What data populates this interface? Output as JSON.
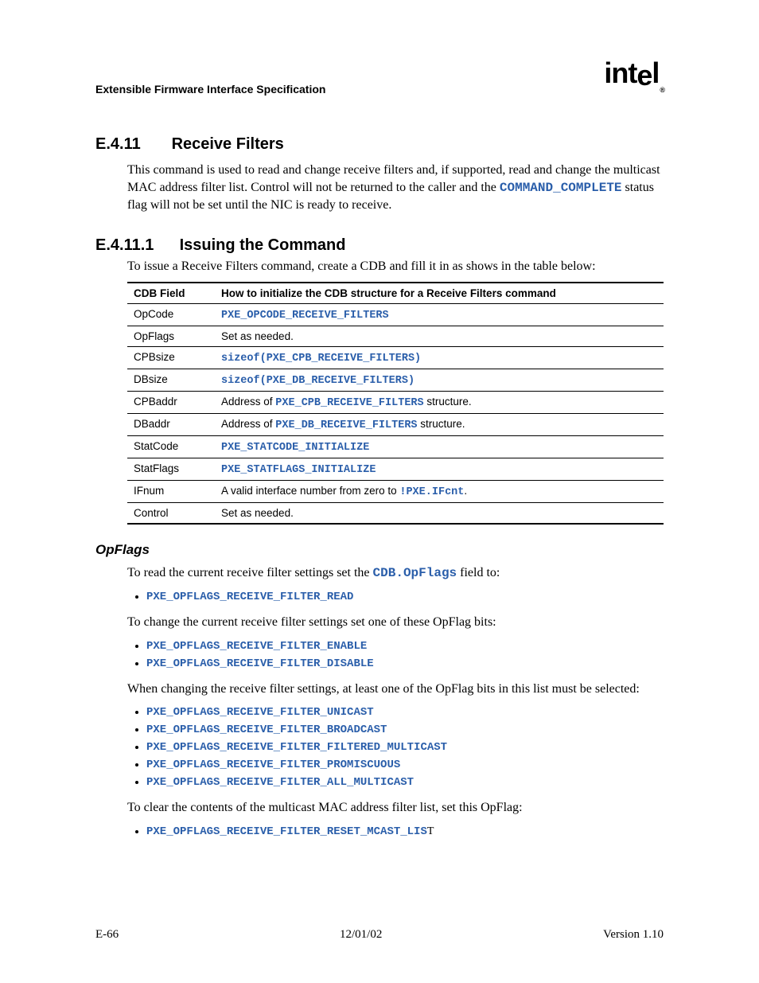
{
  "header": {
    "doc_title": "Extensible Firmware Interface Specification",
    "logo_text": "intel"
  },
  "section": {
    "num": "E.4.11",
    "title": "Receive Filters",
    "body_prefix": "This command is used to read and change receive filters and, if supported, read and change the multicast MAC address filter list.  Control will not be returned to the caller and the ",
    "body_code": "COMMAND_COMPLETE",
    "body_suffix": " status flag will not be set until the NIC is ready to receive."
  },
  "subsection": {
    "num": "E.4.11.1",
    "title": "Issuing the Command",
    "intro": "To issue a Receive Filters command, create a CDB and fill it in as shows in the table below:"
  },
  "table": {
    "head_field": "CDB Field",
    "head_desc": "How to initialize the CDB structure for a Receive Filters command",
    "rows": [
      {
        "field": "OpCode",
        "type": "code",
        "text": "PXE_OPCODE_RECEIVE_FILTERS"
      },
      {
        "field": "OpFlags",
        "type": "plain",
        "text": "Set as needed."
      },
      {
        "field": "CPBsize",
        "type": "code",
        "text": "sizeof(PXE_CPB_RECEIVE_FILTERS)"
      },
      {
        "field": "DBsize",
        "type": "code",
        "text": "sizeof(PXE_DB_RECEIVE_FILTERS)"
      },
      {
        "field": "CPBaddr",
        "type": "mix",
        "pre": "Address of ",
        "code": "PXE_CPB_RECEIVE_FILTERS",
        "post": " structure."
      },
      {
        "field": "DBaddr",
        "type": "mix",
        "pre": "Address of ",
        "code": "PXE_DB_RECEIVE_FILTERS",
        "post": " structure."
      },
      {
        "field": "StatCode",
        "type": "code",
        "text": "PXE_STATCODE_INITIALIZE"
      },
      {
        "field": "StatFlags",
        "type": "code",
        "text": "PXE_STATFLAGS_INITIALIZE"
      },
      {
        "field": "IFnum",
        "type": "mix",
        "pre": "A valid interface number from zero to ",
        "code": "!PXE.IFcnt",
        "post": "."
      },
      {
        "field": "Control",
        "type": "plain",
        "text": "Set as needed."
      }
    ]
  },
  "opflags": {
    "heading": "OpFlags",
    "p1_pre": "To read the current receive filter settings set the ",
    "p1_code": "CDB.OpFlags",
    "p1_post": " field to:",
    "list1": [
      "PXE_OPFLAGS_RECEIVE_FILTER_READ"
    ],
    "p2": "To change the current receive filter settings set one of these OpFlag bits:",
    "list2": [
      "PXE_OPFLAGS_RECEIVE_FILTER_ENABLE",
      "PXE_OPFLAGS_RECEIVE_FILTER_DISABLE"
    ],
    "p3": "When changing the receive filter settings, at least one of the OpFlag bits in this list must be selected:",
    "list3": [
      "PXE_OPFLAGS_RECEIVE_FILTER_UNICAST",
      "PXE_OPFLAGS_RECEIVE_FILTER_BROADCAST",
      "PXE_OPFLAGS_RECEIVE_FILTER_FILTERED_MULTICAST",
      "PXE_OPFLAGS_RECEIVE_FILTER_PROMISCUOUS",
      "PXE_OPFLAGS_RECEIVE_FILTER_ALL_MULTICAST"
    ],
    "p4": "To clear the contents of the multicast MAC address filter list, set this OpFlag:",
    "list4_code": "PXE_OPFLAGS_RECEIVE_FILTER_RESET_MCAST_LIS",
    "list4_tail": "T"
  },
  "footer": {
    "left": "E-66",
    "center": "12/01/02",
    "right": "Version 1.10"
  }
}
